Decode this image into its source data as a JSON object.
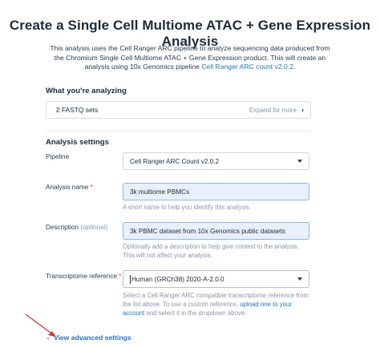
{
  "title": "Create a Single Cell Multiome ATAC + Gene Expression Analysis",
  "intro": {
    "text_before": "This analysis uses the Cell Ranger ARC pipeline to analyze sequencing data produced from the Chromium Single Cell Multiome ATAC + Gene Expression product. This will create an analysis using 10x Genomics pipeline ",
    "link": "Cell Ranger ARC count v2.0.2",
    "text_after": "."
  },
  "analyzing": {
    "heading": "What you're analyzing",
    "count": "2 FASTQ sets",
    "expand": "Expand for more",
    "chevron": "›"
  },
  "settings": {
    "heading": "Analysis settings",
    "pipeline": {
      "label": "Pipeline",
      "value": "Cell Ranger ARC Count v2.0.2"
    },
    "name": {
      "label": "Analysis name",
      "required": "*",
      "value": "3k multiome PBMCs",
      "help": "A short name to help you identify this analysis."
    },
    "description": {
      "label": "Description",
      "optional": "(optional)",
      "value": "3k PBMC dataset from 10x Genomics public datasets",
      "help": "Optionally add a description to help give context to the analysis. This will not affect your analysis."
    },
    "transcriptome": {
      "label": "Transcriptome reference",
      "required": "*",
      "value": "Human (GRCh38) 2020-A-2.0.0",
      "help_before": "Select a Cell Ranger ARC compatible transcriptome reference from the list above. To use a custom reference, ",
      "help_link": "upload one to your account",
      "help_after": " and select it in the dropdown above."
    }
  },
  "advanced": {
    "label": "View advanced settings",
    "chevron": "⌄"
  },
  "colors": {
    "accent": "#1a73c7",
    "annotation_arrow": "#e2332b",
    "input_fill": "#e8f0fc"
  }
}
